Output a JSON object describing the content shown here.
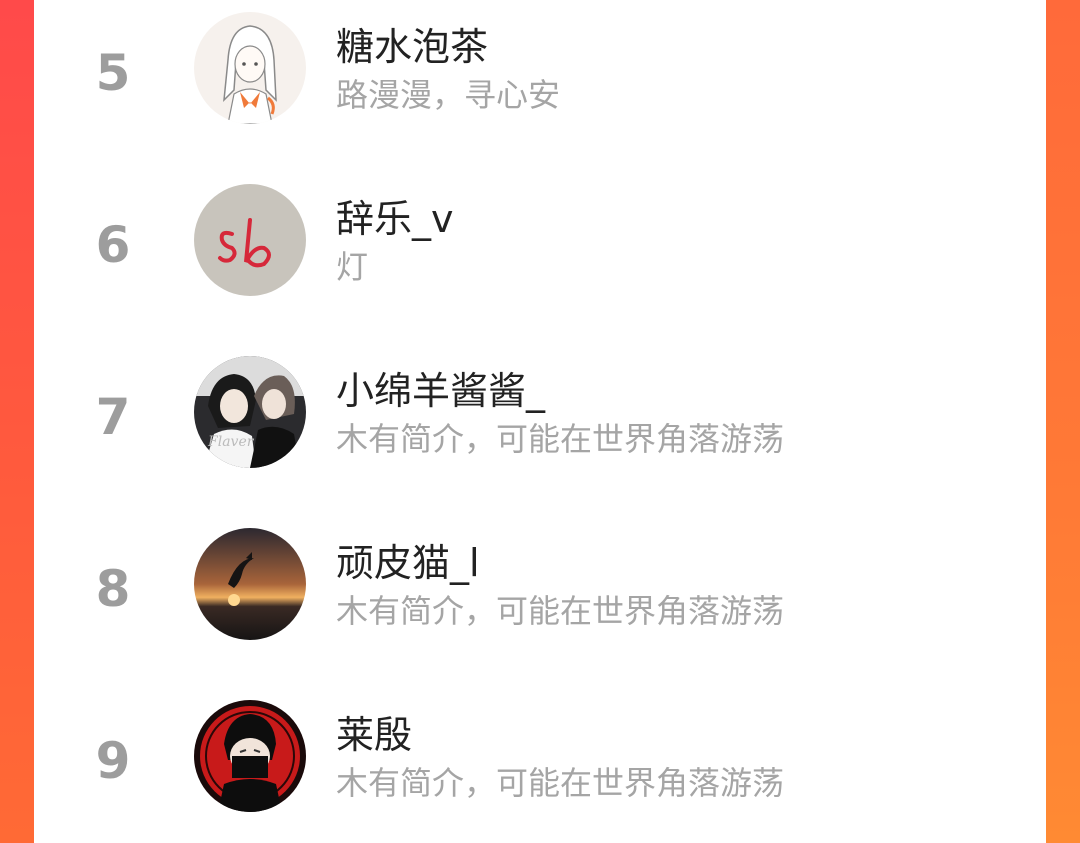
{
  "colors": {
    "background_left": "#ff4a4a",
    "background_right": "#ff7a36",
    "panel": "#ffffff",
    "rank_text": "#9d9d9d",
    "name_text": "#222222",
    "bio_text": "#a5a5a5"
  },
  "ranking": {
    "items": [
      {
        "rank": "5",
        "name": "糖水泡茶",
        "bio": "路漫漫，寻心安",
        "avatar_icon": "anime-girl-sketch-avatar"
      },
      {
        "rank": "6",
        "name": "辞乐_v",
        "bio": "灯",
        "avatar_icon": "handwritten-sb-avatar"
      },
      {
        "rank": "7",
        "name": "小绵羊酱酱_",
        "bio": "木有简介，可能在世界角落游荡",
        "avatar_icon": "anime-couple-avatar"
      },
      {
        "rank": "8",
        "name": "顽皮猫_l",
        "bio": "木有简介，可能在世界角落游荡",
        "avatar_icon": "sunset-dolphin-avatar"
      },
      {
        "rank": "9",
        "name": "莱殷",
        "bio": "木有简介，可能在世界角落游荡",
        "avatar_icon": "masked-ninja-avatar"
      }
    ]
  }
}
